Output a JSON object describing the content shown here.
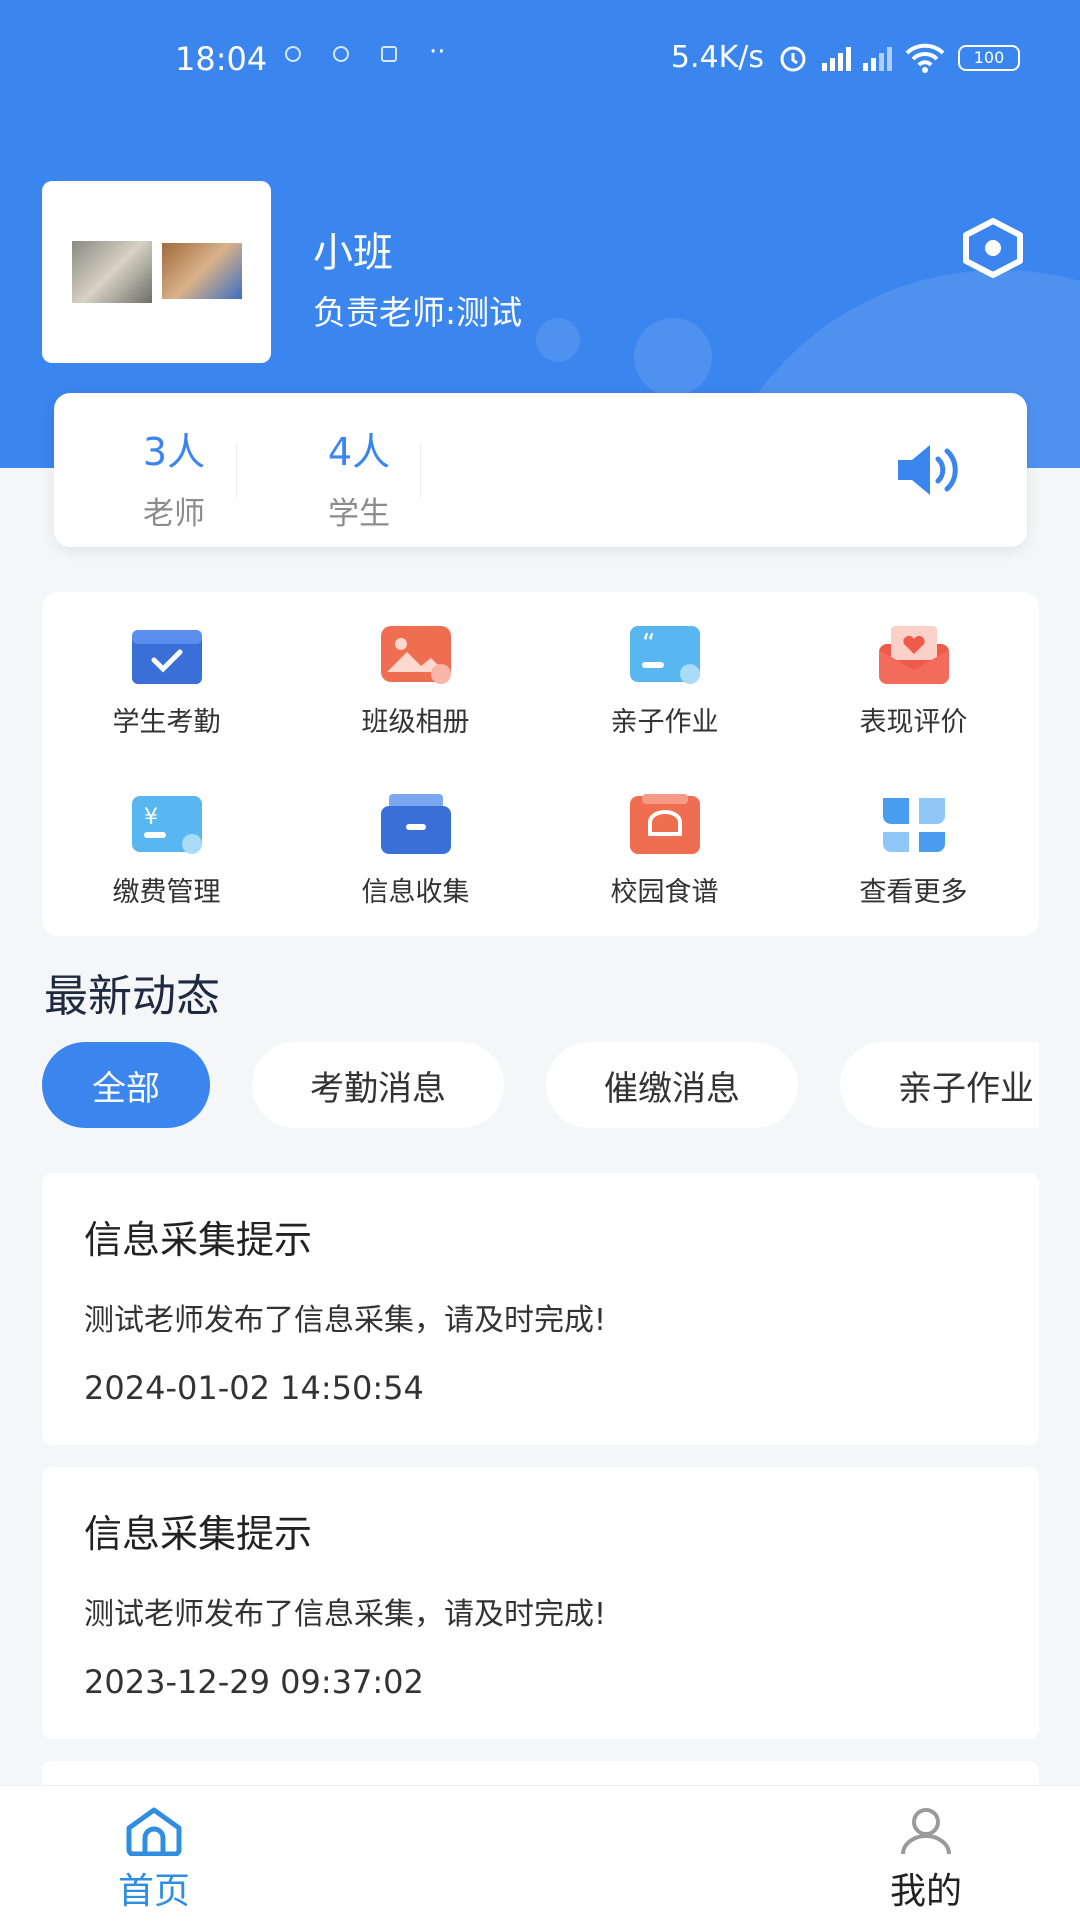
{
  "status_bar": {
    "time": "18:04",
    "network_speed": "5.4K/s",
    "battery": "100"
  },
  "class": {
    "name": "小班",
    "teacher": "负责老师:测试"
  },
  "stats": [
    {
      "value": "3人",
      "label": "老师"
    },
    {
      "value": "4人",
      "label": "学生"
    }
  ],
  "functions": [
    {
      "label": "学生考勤",
      "icon": "attendance-icon"
    },
    {
      "label": "班级相册",
      "icon": "album-icon"
    },
    {
      "label": "亲子作业",
      "icon": "homework-icon"
    },
    {
      "label": "表现评价",
      "icon": "evaluation-icon"
    },
    {
      "label": "缴费管理",
      "icon": "payment-icon"
    },
    {
      "label": "信息收集",
      "icon": "collection-icon"
    },
    {
      "label": "校园食谱",
      "icon": "menu-icon"
    },
    {
      "label": "查看更多",
      "icon": "more-icon"
    }
  ],
  "section_title": "最新动态",
  "filters": [
    "全部",
    "考勤消息",
    "催缴消息",
    "亲子作业"
  ],
  "news": [
    {
      "title": "信息采集提示",
      "desc": "测试老师发布了信息采集，请及时完成!",
      "time": "2024-01-02 14:50:54"
    },
    {
      "title": "信息采集提示",
      "desc": "测试老师发布了信息采集，请及时完成!",
      "time": "2023-12-29 09:37:02"
    }
  ],
  "tabbar": {
    "home": "首页",
    "mine": "我的"
  },
  "colors": {
    "primary": "#3a85ee",
    "background": "#f5f6f8"
  }
}
